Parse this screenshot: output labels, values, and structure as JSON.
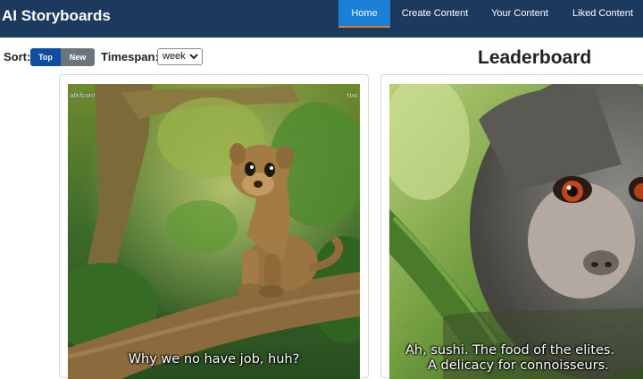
{
  "app": {
    "title": "AI Storyboards"
  },
  "nav": {
    "items": [
      {
        "label": "Home",
        "active": true
      },
      {
        "label": "Create Content",
        "active": false
      },
      {
        "label": "Your Content",
        "active": false
      },
      {
        "label": "Liked Content",
        "active": false
      }
    ]
  },
  "controls": {
    "sort_label": "Sort:",
    "sort_top": "Top",
    "sort_new": "New",
    "timespan_label": "Timespan:",
    "timespan_value": "week"
  },
  "leaderboard": {
    "title": "Leaderboard"
  },
  "cards": [
    {
      "caption": "Why we no have job, huh?",
      "watermark_left": "atkfcon!",
      "watermark_right": "too"
    },
    {
      "caption_line1": "Ah, sushi. The food of the elites.",
      "caption_line2": "A delicacy for connoisseurs."
    }
  ],
  "colors": {
    "navbar": "#1c3a5e",
    "active_tab": "#1a7fd6",
    "sort_active": "#0b4ea2",
    "sort_inactive": "#6c757d"
  }
}
